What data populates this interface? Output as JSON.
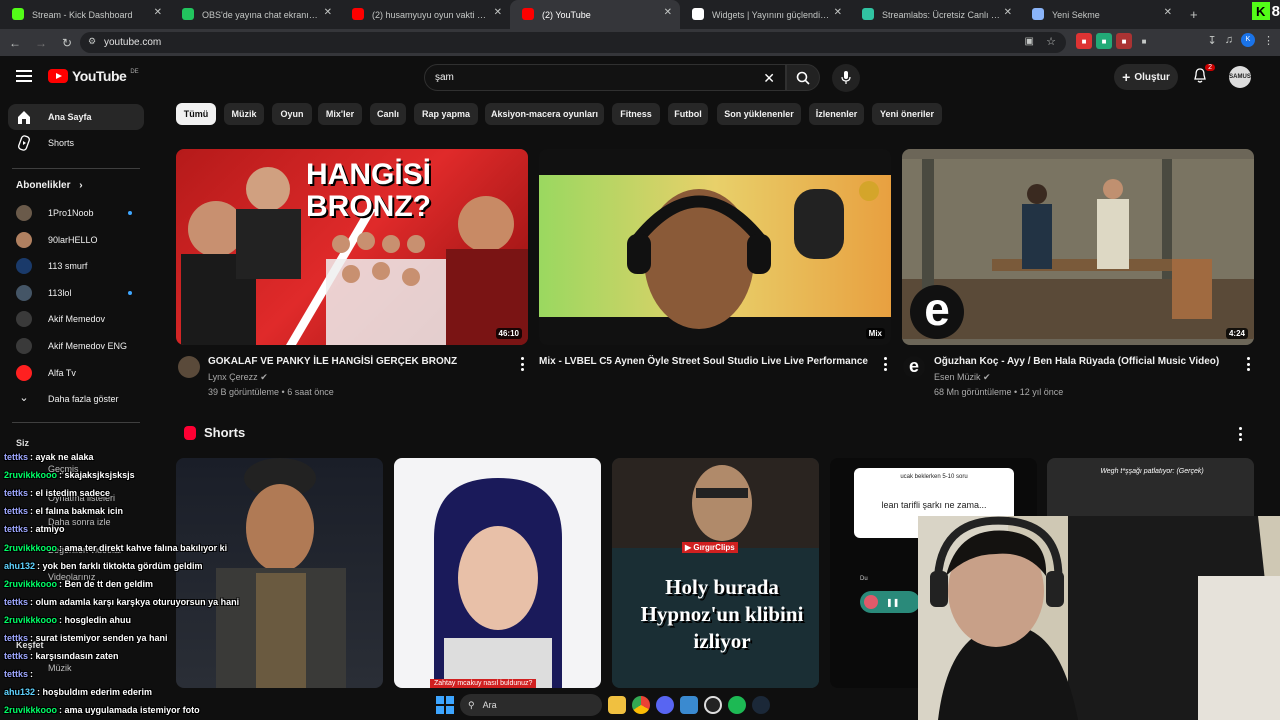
{
  "browser": {
    "tabs": [
      {
        "title": "Stream - Kick Dashboard",
        "color": "#53fc18"
      },
      {
        "title": "OBS'de yayına chat ekranı nasıl",
        "color": "#22c55e"
      },
      {
        "title": "(2) husamyuyu oyun vakti 3 - Y",
        "color": "#ff0000"
      },
      {
        "title": "(2) YouTube",
        "color": "#ff0000"
      },
      {
        "title": "Widgets | Yayınını güçlendirme",
        "color": "#ffffff"
      },
      {
        "title": "Streamlabs: Ücretsiz Canlı Yayı",
        "color": "#31c3a2"
      },
      {
        "title": "Yeni Sekme",
        "color": "#8ab4f8"
      }
    ],
    "active_tab": 3,
    "new_tab_symbol": "+",
    "url": "youtube.com",
    "kick_badge_letter": "K",
    "kick_badge_number": "8"
  },
  "youtube": {
    "logo_text": "YouTube",
    "country_code": "DE",
    "search_value": "şam",
    "create_label": "Oluştur",
    "notif_count": "2",
    "avatar_text": "SAMUS",
    "sidebar": {
      "items": [
        {
          "label": "Ana Sayfa"
        },
        {
          "label": "Shorts"
        }
      ],
      "subs_heading": "Abonelikler",
      "subs": [
        {
          "label": "1Pro1Noob",
          "live": true,
          "color": "#6a5a4a"
        },
        {
          "label": "90larHELLO",
          "live": false,
          "color": "#b08060"
        },
        {
          "label": "113 smurf",
          "live": false,
          "color": "#1a3a6a"
        },
        {
          "label": "113lol",
          "live": true,
          "color": "#445566"
        },
        {
          "label": "Akif Memedov",
          "live": false,
          "color": "#3a3a3a"
        },
        {
          "label": "Akif Memedov ENG",
          "live": false,
          "color": "#3a3a3a"
        },
        {
          "label": "Alfa Tv",
          "live": false,
          "color": "#ff2020"
        }
      ],
      "show_more": "Daha fazla göster"
    },
    "chips": [
      "Tümü",
      "Müzik",
      "Oyun",
      "Mix'ler",
      "Canlı",
      "Rap yapma",
      "Aksiyon-macera oyunları",
      "Fitness",
      "Futbol",
      "Son yüklenenler",
      "İzlenenler",
      "Yeni öneriler"
    ],
    "videos": [
      {
        "thumb_text": "HANGİSİ BRONZ?",
        "duration": "46:10",
        "title": "GOKALAF VE PANKY İLE HANGİSİ GERÇEK BRONZ",
        "channel": "Lynx Çerezz",
        "meta": "39 B görüntüleme • 6 saat önce"
      },
      {
        "thumb_badge": "Mix",
        "title": "Mix - LVBEL C5  Aynen Öyle Street Soul Studio Live  Live Performance",
        "channel": "",
        "meta": ""
      },
      {
        "thumb_logo": "e",
        "duration": "4:24",
        "title": "Oğuzhan Koç - Ayy / Ben Hala Rüyada  (Official Music Video)",
        "channel": "Esen Müzik",
        "meta": "68 Mn görüntüleme • 12 yıl önce"
      }
    ],
    "shorts_title": "Shorts",
    "shorts": [
      {
        "text": ""
      },
      {
        "text": "Zahtay mcakuy nasıl buldunuz?"
      },
      {
        "brand": "GırgırClips",
        "text": "Holy burada Hypnoz'un klibini izliyor"
      },
      {
        "top": "ucak beklerken 5-10 soru",
        "text": "lean tarifli şarkı ne zama...",
        "user": "Du"
      },
      {
        "text": "Wegh t*şşağı patlatıyor: (Gerçek)"
      }
    ]
  },
  "overlay_chat": [
    {
      "user": "tettks",
      "msg": ": ayak ne alaka",
      "color": "#9ea7ff"
    },
    {
      "user": "2ruvikkkooo",
      "msg": ": skajaksjksjsksjs",
      "color": "#00ff66"
    },
    {
      "user": "tettks",
      "msg": ": el istedim sadece",
      "color": "#9ea7ff"
    },
    {
      "user": "tettks",
      "msg": ": el falına bakmak icin",
      "color": "#9ea7ff"
    },
    {
      "user": "tettks",
      "msg": ": atmiyo",
      "color": "#9ea7ff"
    },
    {
      "user": "2ruvikkkooo",
      "msg": ": ama ter direkt kahve falına bakılıyor ki",
      "color": "#00ff66"
    },
    {
      "user": "ahu132",
      "msg": ": yok ben farklı tiktokta gördüm geldim",
      "color": "#5fd3ff"
    },
    {
      "user": "2ruvikkkooo",
      "msg": ": Ben de tt den geldim",
      "color": "#00ff66"
    },
    {
      "user": "tettks",
      "msg": ": olum adamla karşı karşkya oturuyorsun ya hani",
      "color": "#9ea7ff"
    },
    {
      "user": "2ruvikkkooo",
      "msg": ": hosgledin ahuu",
      "color": "#00ff66"
    },
    {
      "user": "tettks",
      "msg": ": surat istemiyor senden ya hani",
      "color": "#9ea7ff"
    },
    {
      "user": "tettks",
      "msg": ": karşısındasın zaten",
      "color": "#9ea7ff"
    },
    {
      "user": "tettks",
      "msg": ":",
      "color": "#9ea7ff"
    },
    {
      "user": "ahu132",
      "msg": ": hoşbuldım ederim ederim",
      "color": "#5fd3ff"
    },
    {
      "user": "2ruvikkkooo",
      "msg": ": ama uygulamada istemiyor foto",
      "color": "#00ff66"
    }
  ],
  "ghost_sidebar": [
    "Siz",
    "Geçmiş",
    "Oynatma listeleri",
    "Daha sonra izle",
    "Beğenilen videolar",
    "Videolarınız",
    "Keşfet",
    "Müzik"
  ],
  "taskbar": {
    "search_label": "Ara"
  }
}
